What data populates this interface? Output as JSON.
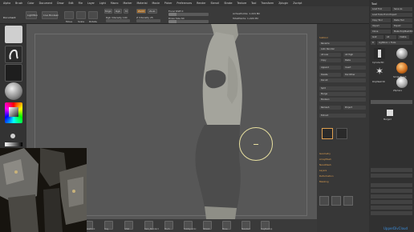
{
  "menu": [
    "Alpha",
    "Brush",
    "Color",
    "Document",
    "Draw",
    "Edit",
    "File",
    "Layer",
    "Light",
    "Macro",
    "Marker",
    "Material",
    "Movie",
    "Picker",
    "Preferences",
    "Render",
    "Stencil",
    "Stroke",
    "Texture",
    "Tool",
    "Transform",
    "Zplugin",
    "Zscript"
  ],
  "toolbar": {
    "document_label": "Document",
    "lightbox_label": "LightBox",
    "preview_label": "Live Boolean",
    "move_label": "Move",
    "scale_label": "Scale",
    "rotate_label": "Rotate",
    "mrgb_label": "Mrgb",
    "rgb_label": "Rgb",
    "m_label": "M",
    "zadd_label": "Zadd",
    "zsub_label": "Zsub",
    "focal_label": "Focal Shift 0",
    "draw_label": "Draw Size 64",
    "rgb_int_label": "Rgb Intensity 100",
    "z_int_label": "Z Intensity 25",
    "active_points": "ActivePoints: 1.224 Mil",
    "total_points": "TotalPoints: 1.224 Mil"
  },
  "left_shelf": {
    "labels": [
      "Clay",
      "Standard",
      "Move"
    ]
  },
  "right_panel": {
    "title": "Subtool",
    "items": [
      "Rename",
      "Auto Reorder",
      "All Low",
      "All High",
      "Copy",
      "Paste",
      "Append",
      "Insert",
      "Delete",
      "Del Other",
      "Del All",
      "Split",
      "Merge",
      "Boolean",
      "Remesh",
      "Project",
      "Extract"
    ],
    "sections": [
      "Geometry",
      "ArrayMesh",
      "NanoMesh",
      "Layers",
      "Deformation",
      "Masking"
    ]
  },
  "tool_tray": {
    "title": "Tool",
    "buttons": [
      "Load Tool",
      "Save As",
      "Load Tools From Project",
      "Copy Tool",
      "Paste Tool",
      "Import",
      "Export",
      "Clone",
      "Make PolyMesh3D",
      "GoZ",
      "All",
      "Visible",
      "R",
      "Lightbox > Tools"
    ],
    "thumb_labels": [
      "Cylinder3D",
      "SimpleBrush",
      "PolyMesh3D",
      "Sphere3D",
      "ZSphere",
      "Merged"
    ]
  },
  "bottom_shelf": {
    "labels": [
      "SnakeHook",
      "Clay",
      "Inflat",
      "Dam_Standard",
      "Pinch",
      "TrimDynamic",
      "hPolish",
      "Move",
      "Standard",
      "ClayBuildup"
    ]
  },
  "watermark": "UpperDivCloud",
  "colors": {
    "background": "#2b2b2b",
    "canvas": "#575757",
    "accent": "#e0a050",
    "skin": "#9a9a92",
    "shorts": "#4a4a4a"
  }
}
